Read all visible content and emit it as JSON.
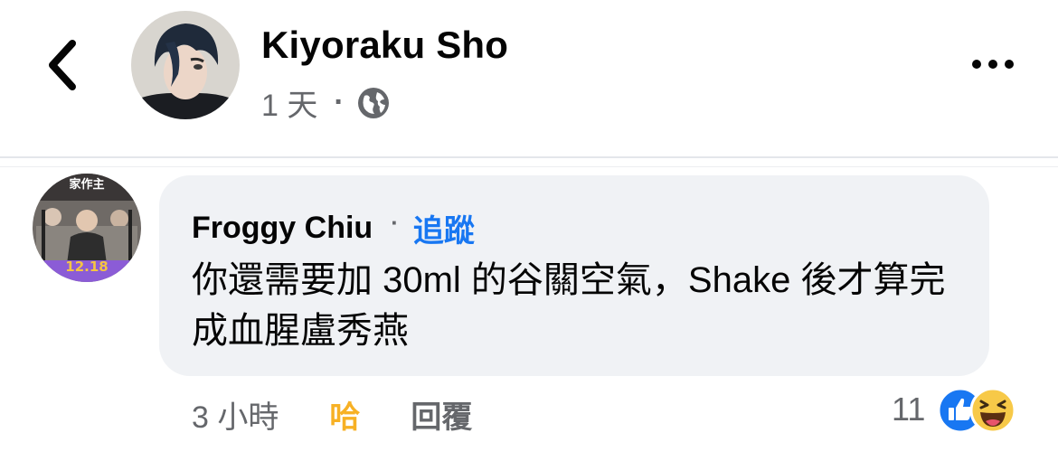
{
  "post": {
    "author_name": "Kiyoraku Sho",
    "time": "1 天",
    "separator": "·",
    "privacy_icon": "globe-icon"
  },
  "nav": {
    "back_icon": "chevron-left-icon",
    "more_icon": "more-dots-icon"
  },
  "comment": {
    "author_name": "Froggy Chiu",
    "separator": "·",
    "follow_label": "追蹤",
    "text": "你還需要加 30ml 的谷關空氣，Shake 後才算完成血腥盧秀燕",
    "time": "3 小時",
    "reaction_label": "哈",
    "reply_label": "回覆",
    "reaction_count": "11",
    "reaction_icons": [
      "like-icon",
      "haha-icon"
    ],
    "avatar_badge": "12.18"
  },
  "colors": {
    "accent": "#1877f2",
    "haha": "#f7b125",
    "muted": "#65676b",
    "bubble": "#f0f2f5"
  }
}
